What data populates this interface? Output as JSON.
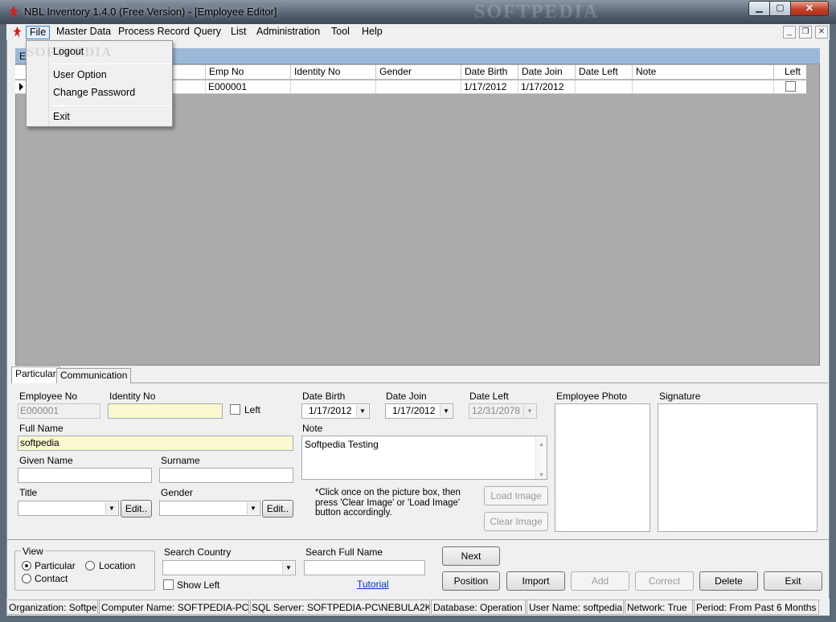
{
  "window": {
    "title": "NBL Inventory 1.4.0 (Free Version) - [Employee Editor]",
    "watermark": "SOFTPEDIA"
  },
  "menu": [
    "File",
    "Master Data",
    "Process Record",
    "Query",
    "List",
    "Administration",
    "Tool",
    "Help"
  ],
  "file_menu": {
    "items": [
      "Logout",
      "User Option",
      "Change Password",
      "Exit"
    ],
    "watermark": "SOFTPEDIA"
  },
  "grid": {
    "caption": "E",
    "columns": [
      "Emp No",
      "Identity No",
      "Gender",
      "Date Birth",
      "Date Join",
      "Date Left",
      "Note",
      "Left"
    ],
    "rows": [
      {
        "emp_no": "E000001",
        "identity_no": "",
        "gender": "",
        "date_birth": "1/17/2012",
        "date_join": "1/17/2012",
        "date_left": "",
        "note": "",
        "left": false
      }
    ]
  },
  "tabs": [
    "Particular",
    "Communication"
  ],
  "form": {
    "employee_no_label": "Employee No",
    "employee_no": "E000001",
    "identity_no_label": "Identity No",
    "identity_no": "",
    "left_label": "Left",
    "date_birth_label": "Date Birth",
    "date_birth": "1/17/2012",
    "date_join_label": "Date Join",
    "date_join": "1/17/2012",
    "date_left_label": "Date Left",
    "date_left": "12/31/2078",
    "employee_photo_label": "Employee Photo",
    "signature_label": "Signature",
    "full_name_label": "Full Name",
    "full_name": "softpedia",
    "note_label": "Note",
    "note": "Softpedia Testing",
    "given_name_label": "Given Name",
    "given_name": "",
    "surname_label": "Surname",
    "surname": "",
    "title_label": "Title",
    "title": "",
    "gender_label": "Gender",
    "gender": "",
    "edit_label": "Edit..",
    "image_hint": "*Click once on the picture box,  then press 'Clear Image' or 'Load Image' button accordingly.",
    "load_image": "Load Image",
    "clear_image": "Clear Image"
  },
  "bottom": {
    "view_label": "View",
    "view_options": [
      "Particular",
      "Location",
      "Contact"
    ],
    "search_country_label": "Search Country",
    "search_country": "",
    "search_full_name_label": "Search Full Name",
    "search_full_name": "",
    "show_left": "Show Left",
    "tutorial": "Tutorial",
    "buttons": {
      "next": "Next",
      "position": "Position",
      "import": "Import",
      "add": "Add",
      "correct": "Correct",
      "delete": "Delete",
      "exit": "Exit"
    }
  },
  "status": {
    "organization": "Organization: Softpedia",
    "computer": "Computer Name: SOFTPEDIA-PC",
    "sql_server": "SQL Server: SOFTPEDIA-PC\\NEBULA2K",
    "database": "Database: Operation",
    "user": "User Name: softpedia",
    "network": "Network: True",
    "period": "Period: From Past 6 Months"
  }
}
